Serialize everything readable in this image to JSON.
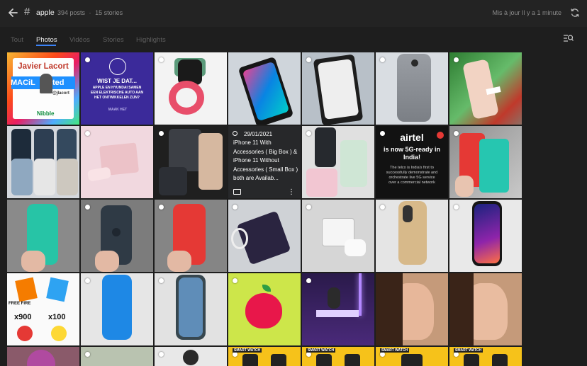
{
  "header": {
    "hash_symbol": "#",
    "tag": "apple",
    "posts": "394 posts",
    "separator": "·",
    "stories": "15 stories",
    "updated": "Mis à jour Il y a 1 minute"
  },
  "tabs": [
    {
      "label": "Tout",
      "active": false
    },
    {
      "label": "Photos",
      "active": true
    },
    {
      "label": "Vidéos",
      "active": false
    },
    {
      "label": "Stories",
      "active": false
    },
    {
      "label": "Highlights",
      "active": false
    }
  ],
  "colors": {
    "accent": "#3b82f6",
    "background": "#1e1e1e",
    "topbar": "#232323"
  },
  "icons": [
    "back-arrow-icon",
    "hash-icon",
    "refresh-icon",
    "filter-search-icon",
    "folder-icon",
    "more-vertical-icon"
  ],
  "tiles_text": {
    "javier_name": "Javier Lacort",
    "maci_text": "MACiL",
    "maci_suffix": "ated",
    "javier_handle": "@jlacort",
    "nibble": "Nibble",
    "wist_title": "WIST JE DAT...",
    "wist_body": "APPLE EN HYUNDAI SAMEN EEN ELEKTRISCHE AUTO AAN HET ONTWIKKELEN ZIJN?",
    "wist_footer": "MAAK HET",
    "airtel_brand": "airtel",
    "airtel_head": "is now 5G-ready in India!",
    "airtel_body": "The telco is India's first to successfully demonstrate and orchestrate live 5G service over a commercial network",
    "free_fire": "FREE FIRE",
    "x900": "x900",
    "x100": "x100",
    "smart_watch": "SMART WATCH"
  },
  "hover_tile": {
    "date": "29/01/2021",
    "caption": "iPhone 11 With Accessories ( Big Box ) & iPhone 11 Without Accessories ( Small Box ) both are Availab...",
    "more_symbol": "⋮"
  }
}
